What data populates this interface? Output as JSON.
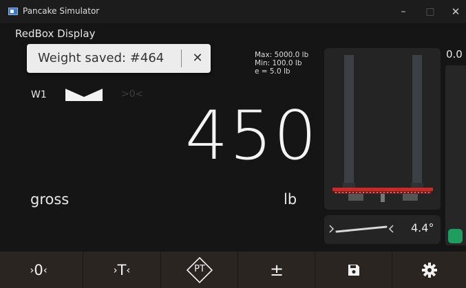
{
  "window": {
    "title": "Pancake Simulator",
    "controls": {
      "minimize": "–",
      "maximize": "□",
      "close": "✕"
    }
  },
  "display_title": "RedBox Display",
  "toast": {
    "message": "Weight saved: #464",
    "close_symbol": "✕"
  },
  "capacity": {
    "max": "Max: 5000.0 lb",
    "min": "Min: 100.0 lb",
    "e": "e =  5.0  lb"
  },
  "scale": {
    "label": "W1",
    "zero_indicator": ">0<",
    "weight": "450",
    "mode": "gross",
    "unit": "lb"
  },
  "tilt": {
    "value": "4.4°"
  },
  "side_gauge": {
    "value": "0.0"
  },
  "toolbar": [
    {
      "id": "zero",
      "label": "0",
      "icon": "zero-icon"
    },
    {
      "id": "tare",
      "label": "T",
      "icon": "tare-icon"
    },
    {
      "id": "preset-tare",
      "label": "PT",
      "icon": "preset-tare-icon"
    },
    {
      "id": "plus-minus",
      "label": "±",
      "icon": "plus-minus-icon"
    },
    {
      "id": "save",
      "icon": "save-icon"
    },
    {
      "id": "settings",
      "icon": "gear-icon"
    }
  ],
  "colors": {
    "status_green": "#1e9e5e",
    "toolbar_bg": "#2b2522",
    "forks_red": "#c82a2a"
  }
}
